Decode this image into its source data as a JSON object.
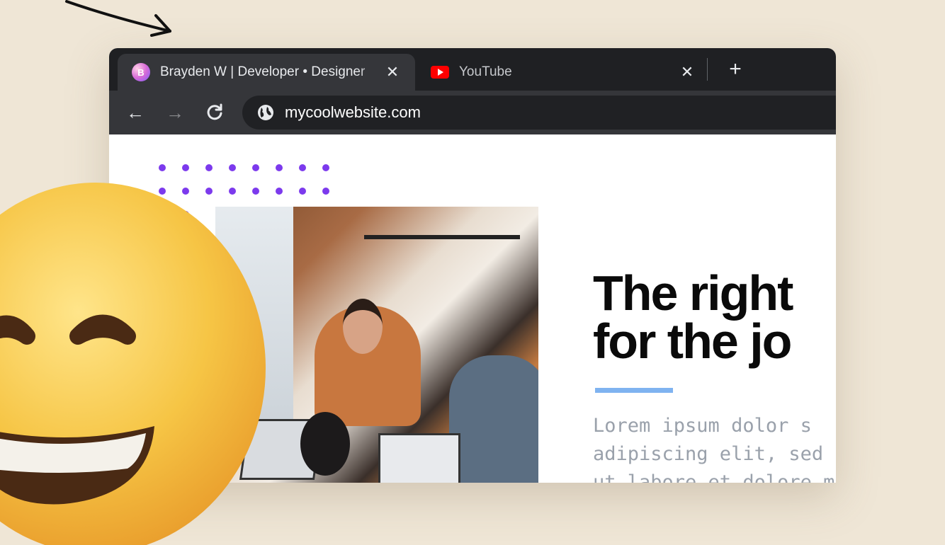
{
  "browser": {
    "tabs": [
      {
        "favicon": "B",
        "title": "Brayden W | Developer • Designer",
        "active": true
      },
      {
        "favicon": "youtube-icon",
        "title": "YouTube",
        "active": false
      }
    ],
    "new_tab_label": "+",
    "url": "mycoolwebsite.com"
  },
  "hero": {
    "title_line1": "The right",
    "title_line2": "for the jo",
    "body": "Lorem ipsum dolor s\nadipiscing elit, sed d\nut labore et dolore m"
  },
  "colors": {
    "page_background": "#efe6d6",
    "dots": "#7c3aed",
    "accent_line": "#7fb3f0",
    "youtube_red": "#ff0000"
  }
}
